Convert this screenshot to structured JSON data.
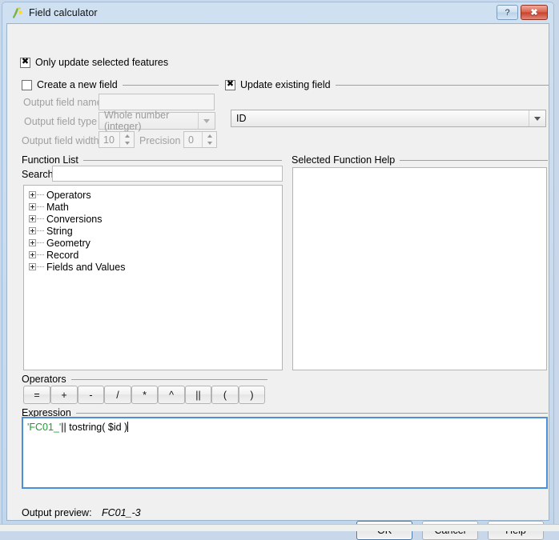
{
  "window": {
    "title": "Field calculator",
    "icon": "qgis-field-calculator-icon",
    "help_button": "?",
    "close_button": "✖"
  },
  "options": {
    "only_update_selected": {
      "label": "Only update selected features",
      "checked": true
    }
  },
  "create_new_field": {
    "group_label": "Create a new field",
    "checked": false,
    "enabled": false,
    "output_field_name": {
      "label": "Output field name",
      "value": "",
      "placeholder": ""
    },
    "output_field_type": {
      "label": "Output field type",
      "value": "Whole number (integer)"
    },
    "output_field_width": {
      "label": "Output field width",
      "value": "10"
    },
    "precision": {
      "label": "Precision",
      "value": "0"
    }
  },
  "update_existing_field": {
    "group_label": "Update existing field",
    "checked": true,
    "field": {
      "value": "ID"
    }
  },
  "function_list": {
    "group_label": "Function List",
    "search_label": "Search",
    "search_value": "",
    "nodes": [
      {
        "label": "Operators"
      },
      {
        "label": "Math"
      },
      {
        "label": "Conversions"
      },
      {
        "label": "String"
      },
      {
        "label": "Geometry"
      },
      {
        "label": "Record"
      },
      {
        "label": "Fields and Values"
      }
    ]
  },
  "selected_function_help": {
    "group_label": "Selected Function Help",
    "content": ""
  },
  "operators": {
    "group_label": "Operators",
    "buttons": [
      {
        "label": "="
      },
      {
        "label": "+"
      },
      {
        "label": "-"
      },
      {
        "label": "/"
      },
      {
        "label": "*"
      },
      {
        "label": "^"
      },
      {
        "label": "||"
      },
      {
        "label": "("
      },
      {
        "label": ")"
      }
    ]
  },
  "expression": {
    "group_label": "Expression",
    "text": "'FC01_'|| tostring( $id )",
    "tokens": {
      "string_literal": "'FC01_'",
      "rest": "|| tostring( $id )"
    },
    "string_color": "#1f9b34"
  },
  "output_preview": {
    "label": "Output preview:",
    "value": "FC01_-3"
  },
  "dialog_buttons": {
    "ok": "OK",
    "cancel": "Cancel",
    "help": "Help"
  }
}
